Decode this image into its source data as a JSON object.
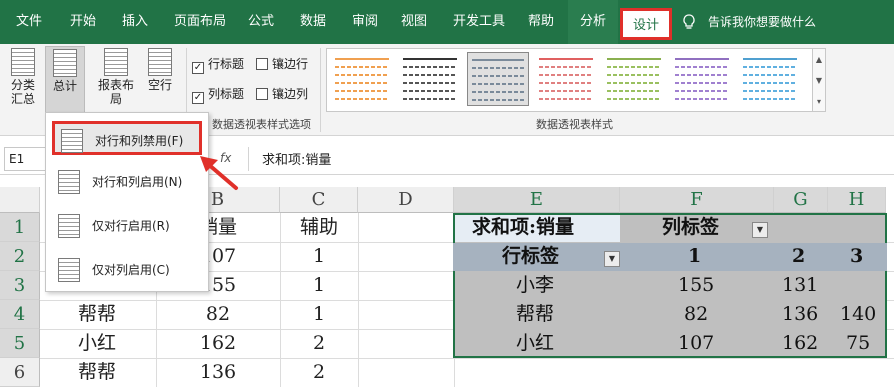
{
  "tabs": {
    "file": "文件",
    "home": "开始",
    "insert": "插入",
    "layout": "页面布局",
    "formulas": "公式",
    "data": "数据",
    "review": "审阅",
    "view": "视图",
    "developer": "开发工具",
    "help": "帮助",
    "analyze": "分析",
    "design": "设计",
    "tell_me": "告诉我你想要做什么"
  },
  "ribbon": {
    "subtotals": "分类汇总",
    "grand_totals": "总计",
    "report_layout": "报表布局",
    "blank_rows": "空行",
    "row_headers": "行标题",
    "banded_rows": "镶边行",
    "column_headers": "列标题",
    "banded_columns": "镶边列",
    "style_options_group": "数据透视表样式选项",
    "styles_group": "数据透视表样式"
  },
  "colors": {
    "excel_green": "#217346",
    "highlight_red": "#e0302a"
  },
  "menu": {
    "items": [
      {
        "label": "对行和列禁用(F)",
        "selected": true
      },
      {
        "label": "对行和列启用(N)",
        "selected": false
      },
      {
        "label": "仅对行启用(R)",
        "selected": false
      },
      {
        "label": "仅对列启用(C)",
        "selected": false
      }
    ]
  },
  "formula_bar": {
    "name_box": "E1",
    "fx": "fx",
    "content": "求和项:销量"
  },
  "grid": {
    "columns": [
      "B",
      "C",
      "D",
      "E",
      "F",
      "G",
      "H"
    ],
    "rows": [
      "1",
      "2",
      "3",
      "4",
      "5",
      "6"
    ],
    "col_b": [
      "销量",
      "107",
      "155",
      "82",
      "162",
      "136"
    ],
    "col_c": [
      "辅助",
      "1",
      "1",
      "1",
      "2",
      "2"
    ],
    "col_a_visible": [
      "帮帮",
      "小红",
      "帮帮"
    ]
  },
  "pivot": {
    "value_field": "求和项:销量",
    "col_label": "列标签",
    "row_label": "行标签",
    "col_keys": [
      "1",
      "2",
      "3"
    ],
    "rows": [
      {
        "name": "小李",
        "v1": "155",
        "v2": "131",
        "v3": ""
      },
      {
        "name": "帮帮",
        "v1": "82",
        "v2": "136",
        "v3": "140"
      },
      {
        "name": "小红",
        "v1": "107",
        "v2": "162",
        "v3": "75"
      }
    ]
  }
}
